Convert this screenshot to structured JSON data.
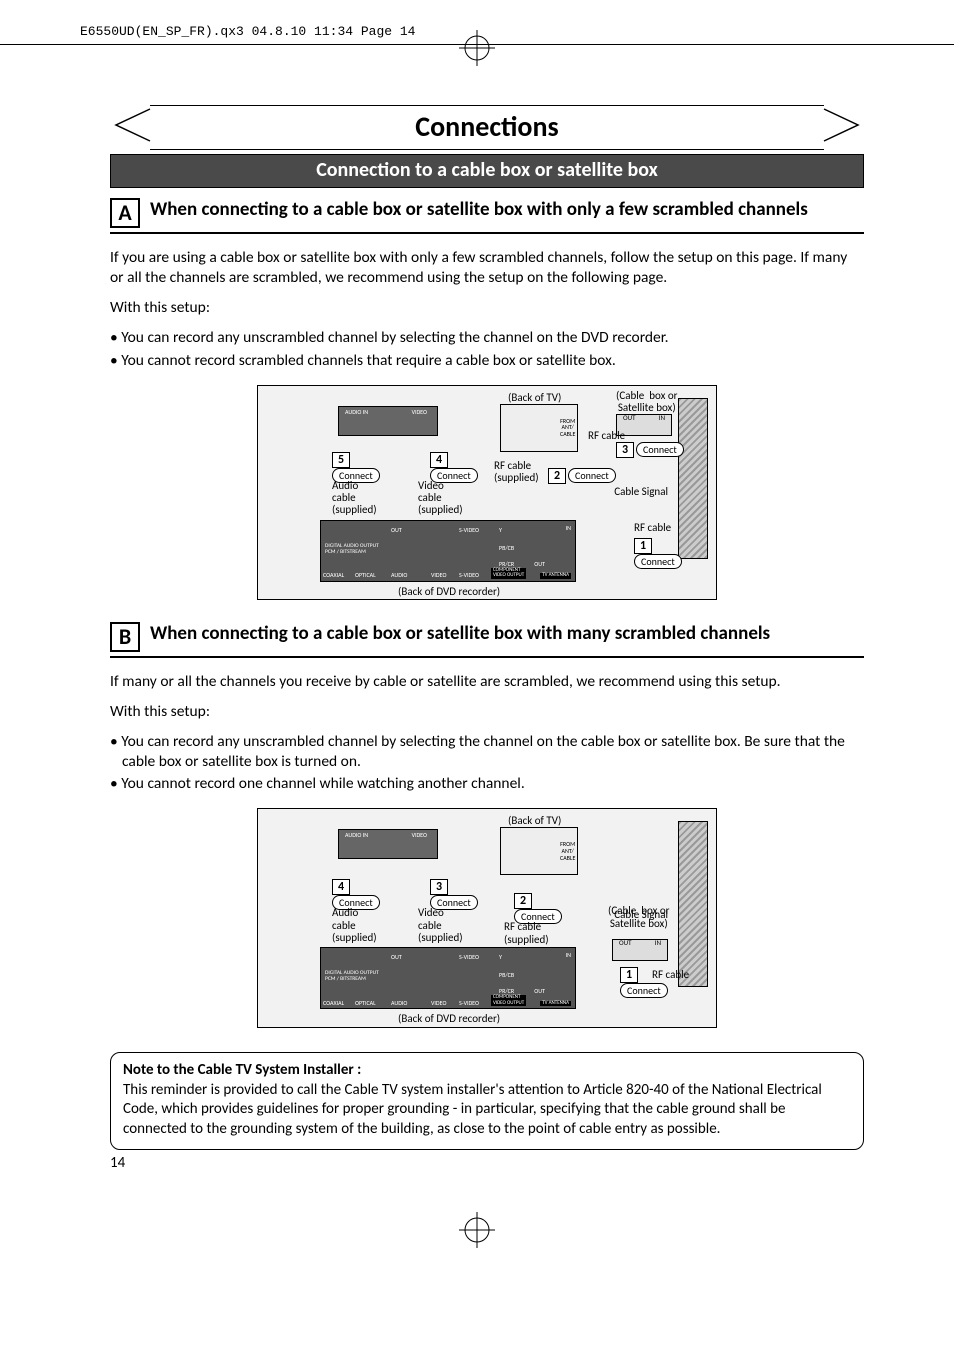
{
  "print_header": "E6550UD(EN_SP_FR).qx3  04.8.10  11:34  Page 14",
  "banner_title": "Connections",
  "subbanner": "Connection to a cable box or satellite box",
  "sectionA": {
    "letter": "A",
    "title": "When connecting to a cable box or satellite box with only a few scrambled channels",
    "intro": "If you are using a cable box or satellite box with only a few scrambled channels, follow the setup on this page. If many or all the channels are scrambled, we recommend using the setup on the following page.",
    "with_setup": "With this setup:",
    "bullets": [
      "You can record any unscrambled channel by selecting the channel on the DVD recorder.",
      "You cannot record scrambled channels that require a cable box or satellite box."
    ]
  },
  "sectionB": {
    "letter": "B",
    "title": "When connecting to a cable box or satellite box with many scrambled channels",
    "intro": "If many or all the channels you receive by cable or satellite are scrambled, we recommend using this setup.",
    "with_setup": "With this setup:",
    "bullets": [
      "You can record any unscrambled channel by selecting the channel on the cable box or satellite box. Be sure that the cable box or satellite box is turned on.",
      "You cannot record one channel while watching another channel."
    ]
  },
  "diagram": {
    "back_of_tv": "(Back of TV)",
    "back_of_recorder": "(Back of DVD recorder)",
    "cable_or_sat": "(Cable  box or\nSatellite box)",
    "cable_signal": "Cable\nSignal",
    "rf_cable": "RF cable",
    "rf_cable_supplied": "RF cable\n(supplied)",
    "audio_cable": "Audio\ncable\n(supplied)",
    "video_cable": "Video\ncable\n(supplied)",
    "audio_in": "AUDIO IN",
    "video": "VIDEO",
    "out": "OUT",
    "in": "IN",
    "ant_in": "ANT\nIN",
    "from_cable": "FROM\nANT/\nCABLE",
    "tv_antenna": "TV ANTENNA",
    "digital_audio": "DIGITAL AUDIO OUTPUT\nPCM / BITSTREAM",
    "coaxial": "COAXIAL",
    "optical": "OPTICAL",
    "out_label": "OUT",
    "audio_label": "AUDIO",
    "video_label": "VIDEO",
    "svideo": "S-VIDEO",
    "component": "COMPONENT\nVIDEO OUTPUT",
    "y": "Y",
    "pbcb": "PB/CB",
    "prcr": "PR/CR",
    "connect": "Connect",
    "steps": [
      "1",
      "2",
      "3",
      "4",
      "5"
    ]
  },
  "note": {
    "title": "Note to the Cable TV System Installer :",
    "body": "This reminder is provided to call the Cable TV system installer's attention to Article 820-40 of the National Electrical Code, which provides guidelines for proper grounding - in particular, specifying that the cable ground shall be connected to the grounding system of the building, as close to the point of cable entry as possible."
  },
  "page_number": "14"
}
